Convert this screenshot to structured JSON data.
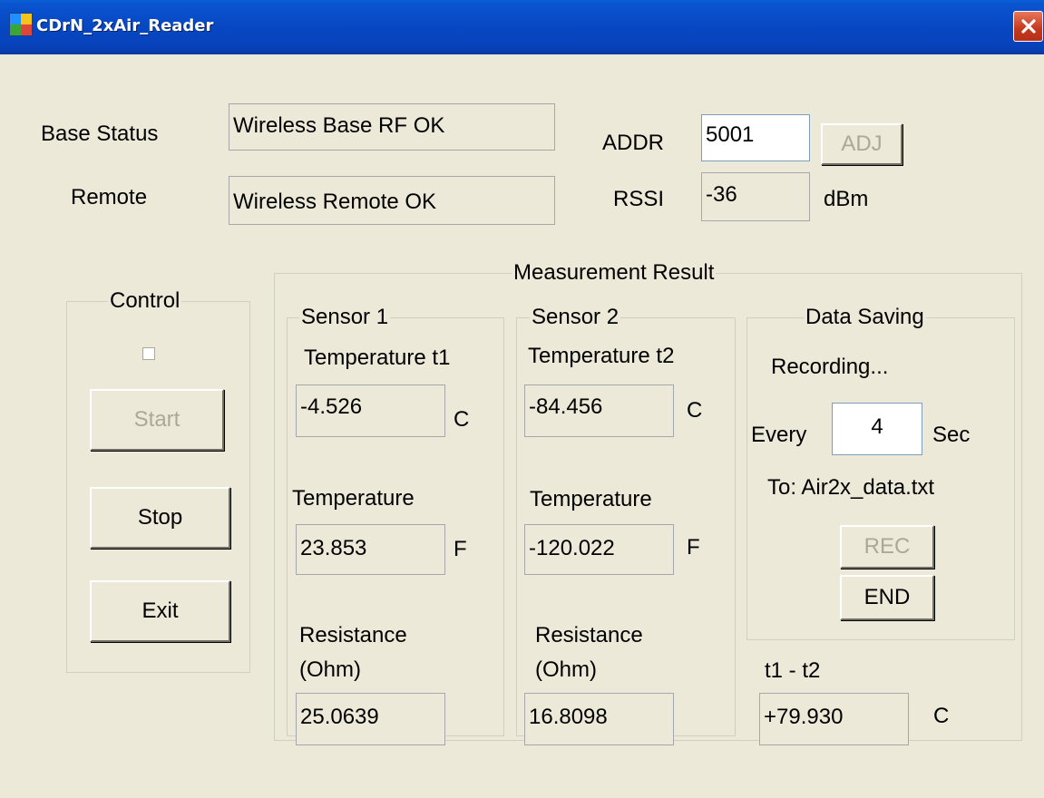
{
  "window": {
    "title": "CDrN_2xAir_Reader"
  },
  "status": {
    "base_label": "Base Status",
    "base_value": "Wireless Base RF OK",
    "remote_label": "Remote",
    "remote_value": "Wireless Remote OK",
    "addr_label": "ADDR",
    "addr_value": "5001",
    "adj_label": "ADJ",
    "rssi_label": "RSSI",
    "rssi_value": "-36",
    "rssi_unit": "dBm"
  },
  "control": {
    "group_label": "Control",
    "start_label": "Start",
    "stop_label": "Stop",
    "exit_label": "Exit"
  },
  "measurement": {
    "group_label": "Measurement Result",
    "sensor1": {
      "group_label": "Sensor 1",
      "temp_c_label": "Temperature t1",
      "temp_c_value": "-4.526",
      "temp_c_unit": "C",
      "temp_f_label": "Temperature",
      "temp_f_value": "23.853",
      "temp_f_unit": "F",
      "res_label_1": "Resistance",
      "res_label_2": "(Ohm)",
      "res_value": "25.0639"
    },
    "sensor2": {
      "group_label": "Sensor 2",
      "temp_c_label": "Temperature t2",
      "temp_c_value": "-84.456",
      "temp_c_unit": "C",
      "temp_f_label": "Temperature",
      "temp_f_value": "-120.022",
      "temp_f_unit": "F",
      "res_label_1": "Resistance",
      "res_label_2": "(Ohm)",
      "res_value": "16.8098"
    },
    "saving": {
      "group_label": "Data Saving",
      "status": "Recording...",
      "every_label": "Every",
      "every_value": "4",
      "every_unit": "Sec",
      "to_label": "To: Air2x_data.txt",
      "rec_label": "REC",
      "end_label": "END"
    },
    "diff": {
      "label": "t1 - t2",
      "value": "+79.930",
      "unit": "C"
    }
  }
}
